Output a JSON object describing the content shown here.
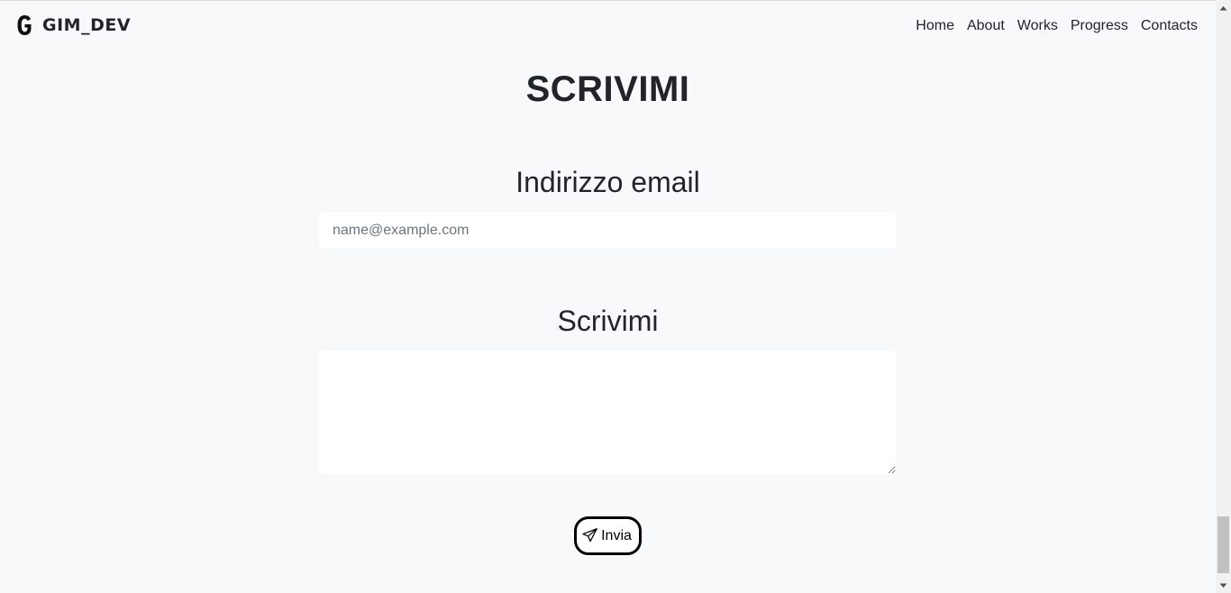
{
  "navbar": {
    "brand_text": "GIM_DEV",
    "links": [
      {
        "label": "Home"
      },
      {
        "label": "About"
      },
      {
        "label": "Works"
      },
      {
        "label": "Progress"
      },
      {
        "label": "Contacts"
      }
    ]
  },
  "contact": {
    "title": "SCRIVIMI",
    "email_label": "Indirizzo email",
    "email_placeholder": "name@example.com",
    "email_value": "",
    "message_label": "Scrivimi",
    "message_value": "",
    "send_label": "Invia",
    "send_icon": "send-icon"
  },
  "scrollbar": {
    "scroll_position": 0.93
  }
}
